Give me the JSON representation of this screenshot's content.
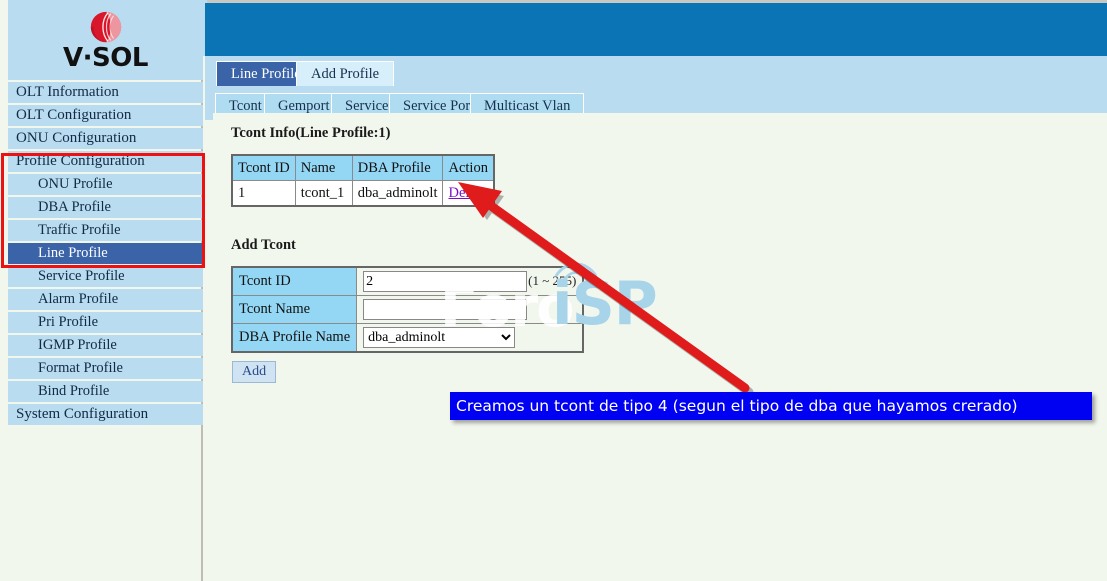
{
  "brand": {
    "logo_text": "V·SOL",
    "logo_icon": "vsol-sphere-logo"
  },
  "sidebar": {
    "items": [
      {
        "label": "OLT Information",
        "level": "top",
        "active": false
      },
      {
        "label": "OLT Configuration",
        "level": "top",
        "active": false
      },
      {
        "label": "ONU Configuration",
        "level": "top",
        "active": false
      },
      {
        "label": "Profile Configuration",
        "level": "top",
        "active": false
      },
      {
        "label": "ONU Profile",
        "level": "sub",
        "active": false
      },
      {
        "label": "DBA Profile",
        "level": "sub",
        "active": false
      },
      {
        "label": "Traffic Profile",
        "level": "sub",
        "active": false
      },
      {
        "label": "Line Profile",
        "level": "sub",
        "active": true
      },
      {
        "label": "Service Profile",
        "level": "sub",
        "active": false
      },
      {
        "label": "Alarm Profile",
        "level": "sub",
        "active": false
      },
      {
        "label": "Pri Profile",
        "level": "sub",
        "active": false
      },
      {
        "label": "IGMP Profile",
        "level": "sub",
        "active": false
      },
      {
        "label": "Format Profile",
        "level": "sub",
        "active": false
      },
      {
        "label": "Bind Profile",
        "level": "sub",
        "active": false
      },
      {
        "label": "System Configuration",
        "level": "top",
        "active": false
      }
    ],
    "highlight_color": "#ee1111"
  },
  "tabs_top": [
    {
      "label": "Line Profile",
      "selected": true
    },
    {
      "label": "Add Profile",
      "selected": false
    }
  ],
  "tabs_sub": [
    {
      "label": "Tcont",
      "selected": true
    },
    {
      "label": "Gemport",
      "selected": false
    },
    {
      "label": "Service",
      "selected": false
    },
    {
      "label": "Service Port",
      "selected": false
    },
    {
      "label": "Multicast Vlan",
      "selected": false
    }
  ],
  "tcont_info": {
    "title": "Tcont Info(Line Profile:1)",
    "columns": [
      "Tcont ID",
      "Name",
      "DBA Profile",
      "Action"
    ],
    "rows": [
      {
        "tcont_id": "1",
        "name": "tcont_1",
        "dba_profile": "dba_adminolt",
        "action": "Delete"
      }
    ]
  },
  "add_tcont": {
    "title": "Add Tcont",
    "fields": {
      "tcont_id_label": "Tcont ID",
      "tcont_id_value": "2",
      "tcont_id_hint": "(1 ~ 255)",
      "tcont_name_label": "Tcont Name",
      "tcont_name_value": "",
      "dba_profile_label": "DBA Profile Name",
      "dba_profile_value": "dba_adminolt",
      "dba_profile_options": [
        "dba_adminolt"
      ]
    },
    "add_button": "Add"
  },
  "watermark": {
    "part1": "Foro",
    "part2": "iSP"
  },
  "annotation": {
    "text": "Creamos un tcont de tipo 4 (segun el tipo de dba que hayamos crerado)",
    "box_color": "#0000f2",
    "arrow_color": "#e01b1b"
  }
}
